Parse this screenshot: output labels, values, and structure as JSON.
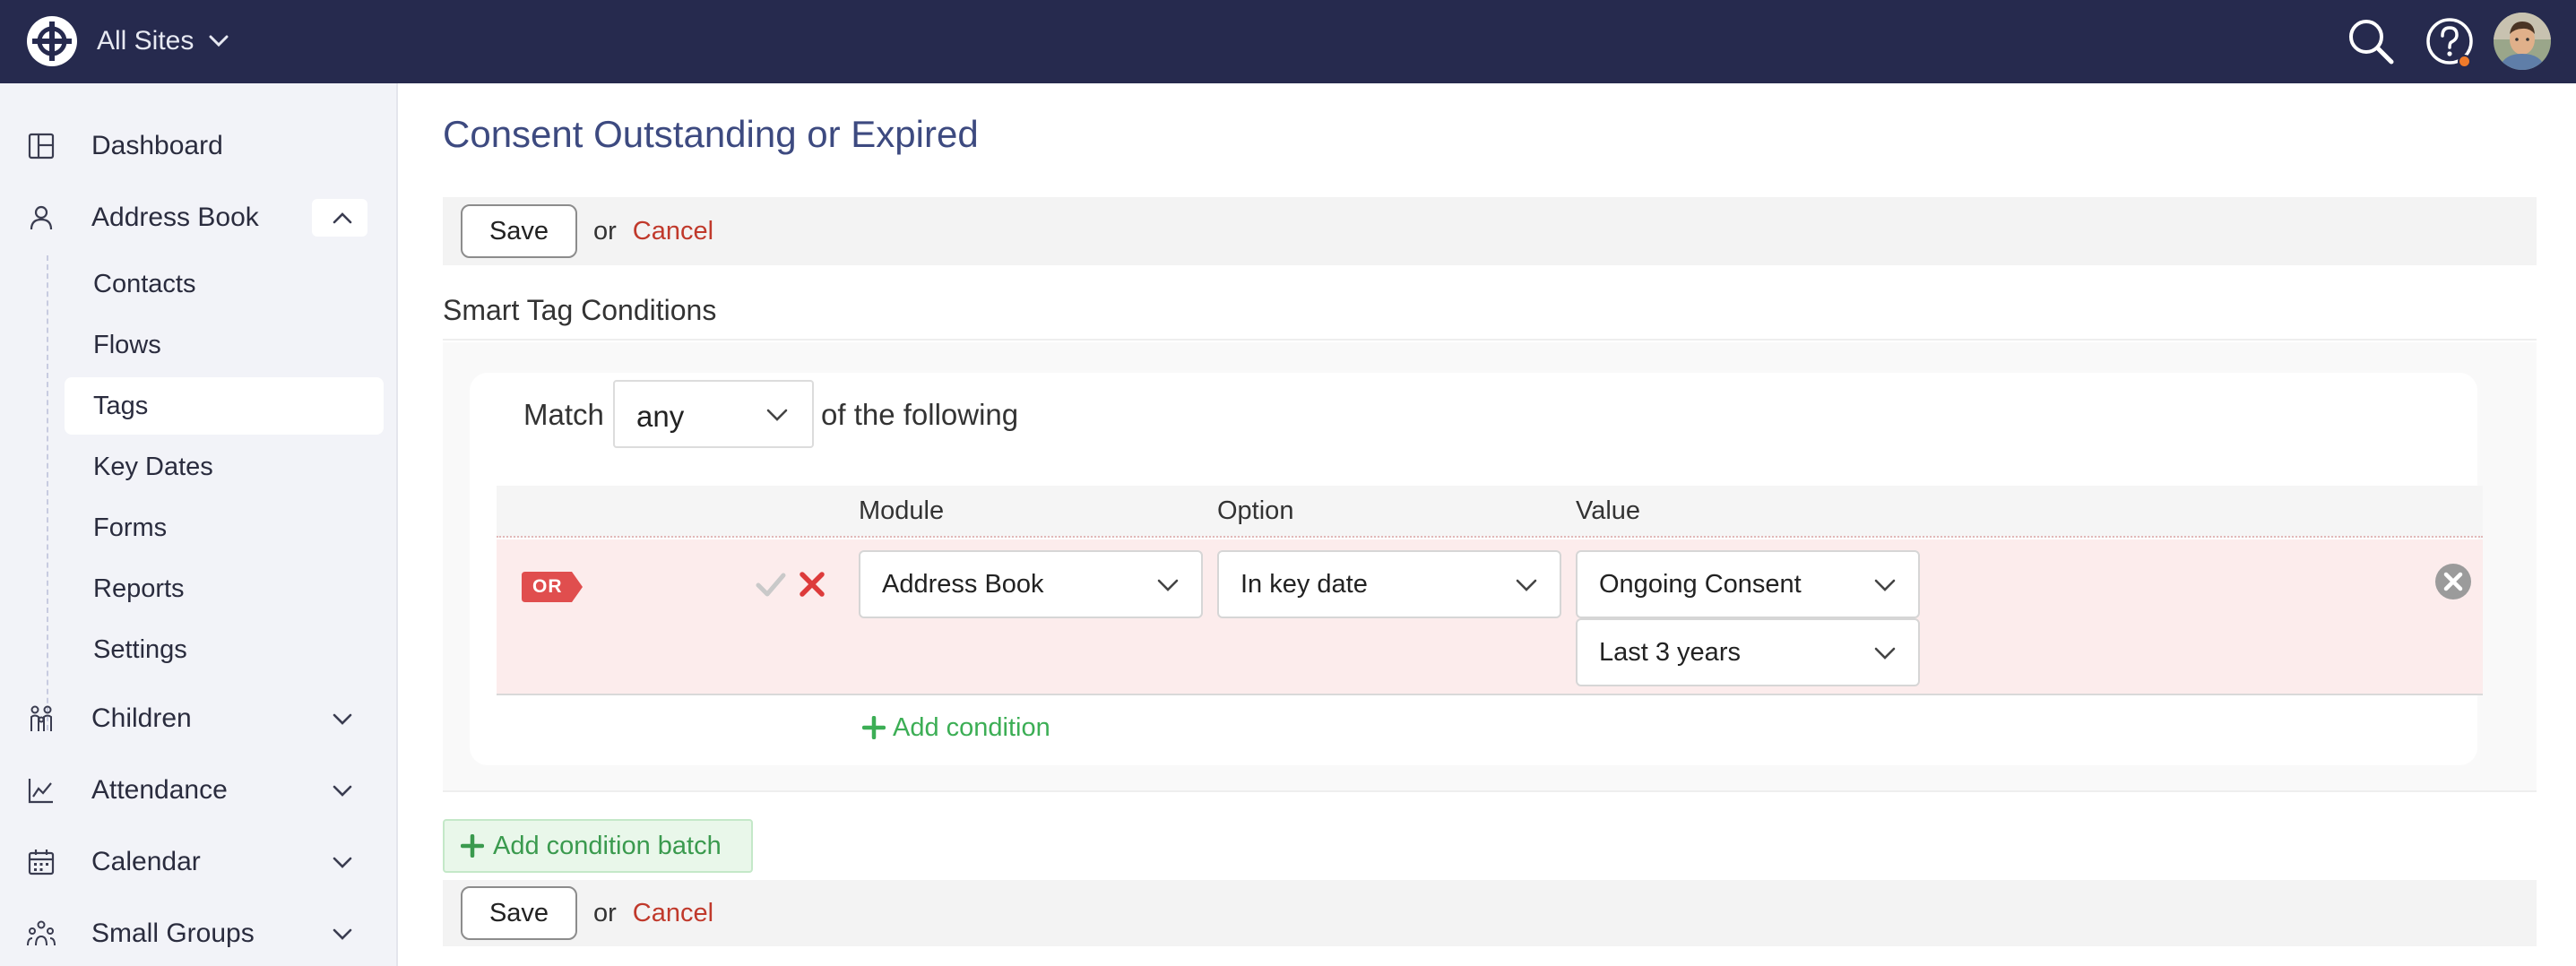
{
  "topbar": {
    "site_label": "All Sites",
    "icons": {
      "logo": "globe-logo-icon",
      "search": "search-icon",
      "help": "help-icon",
      "avatar": "user-avatar"
    },
    "colors": {
      "bg": "#262a4e",
      "notification_dot": "#ef7a2a"
    }
  },
  "sidebar": {
    "items": [
      {
        "label": "Dashboard",
        "icon": "dashboard-icon"
      },
      {
        "label": "Address Book",
        "icon": "person-icon",
        "expanded": true
      },
      {
        "label": "Children",
        "icon": "children-icon"
      },
      {
        "label": "Attendance",
        "icon": "chart-icon"
      },
      {
        "label": "Calendar",
        "icon": "calendar-icon"
      },
      {
        "label": "Small Groups",
        "icon": "group-icon"
      }
    ],
    "address_book_sub": [
      {
        "label": "Contacts"
      },
      {
        "label": "Flows"
      },
      {
        "label": "Tags",
        "active": true
      },
      {
        "label": "Key Dates"
      },
      {
        "label": "Forms"
      },
      {
        "label": "Reports"
      },
      {
        "label": "Settings"
      }
    ]
  },
  "main": {
    "title": "Consent Outstanding or Expired",
    "actions": {
      "save_label": "Save",
      "or_text": "or",
      "cancel_label": "Cancel"
    },
    "section_title": "Smart Tag Conditions",
    "match": {
      "prefix": "Match",
      "value": "any",
      "suffix": "of the following"
    },
    "columns": {
      "module": "Module",
      "option": "Option",
      "value": "Value"
    },
    "condition": {
      "badge": "OR",
      "module": "Address Book",
      "option": "In key date",
      "value": "Ongoing Consent",
      "range": "Last 3 years"
    },
    "add_condition_label": "Add condition",
    "add_batch_label": "Add condition batch",
    "colors": {
      "title": "#3d4a80",
      "cancel": "#c0392b",
      "add_green": "#3cae55",
      "row_bg": "#fcecec",
      "badge_red": "#e04e4e"
    }
  }
}
